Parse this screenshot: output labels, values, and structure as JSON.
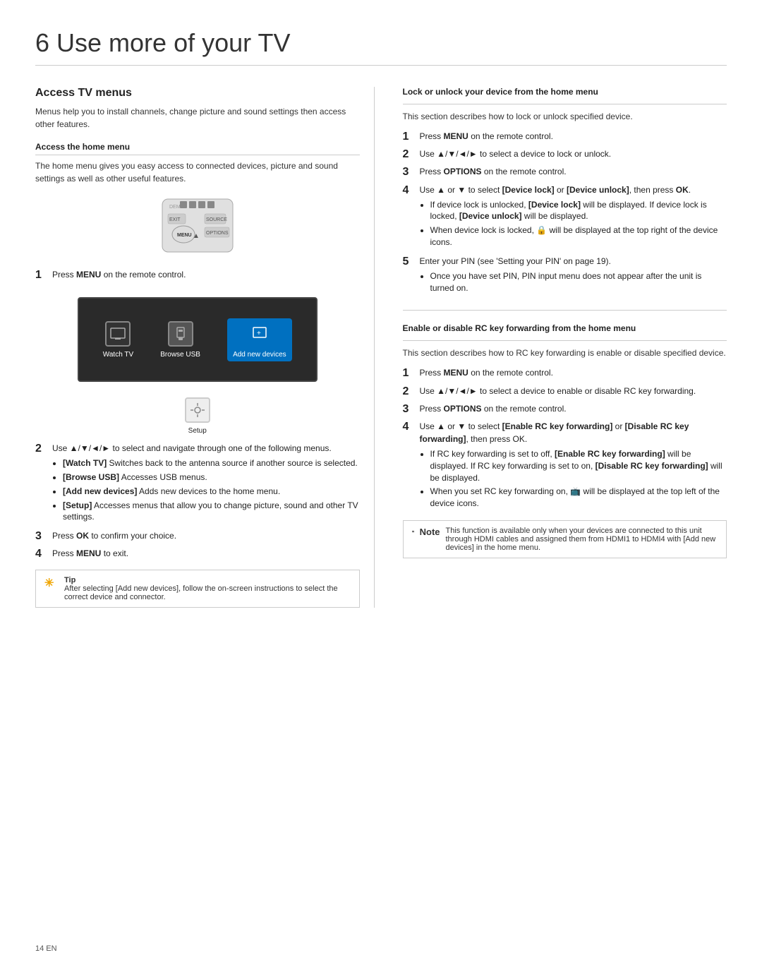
{
  "page": {
    "title": "6   Use more of your TV",
    "page_number": "14   EN"
  },
  "left": {
    "section_title": "Access TV menus",
    "intro_text": "Menus help you to install channels, change picture and sound settings then access other features.",
    "home_menu_subtitle": "Access the home menu",
    "home_menu_text": "The home menu gives you easy access to connected devices, picture and sound settings as well as other useful features.",
    "menu_items": [
      {
        "label": "Watch TV",
        "type": "tv"
      },
      {
        "label": "Browse USB",
        "type": "usb"
      },
      {
        "label": "Add new devices",
        "type": "add"
      },
      {
        "label": "Setup",
        "type": "setup"
      }
    ],
    "steps": [
      {
        "num": "1",
        "text": "Press MENU on the remote control.",
        "bold_word": "MENU"
      },
      {
        "num": "2",
        "text": "Use ▲/▼/◄/► to select and navigate through one of the following menus.",
        "bullets": [
          "[Watch TV] Switches back to the antenna source if another source is selected.",
          "[Browse USB] Accesses USB menus.",
          "[Add new devices] Adds new devices to the home menu.",
          "[Setup] Accesses menus that allow you to change picture, sound and other TV settings."
        ]
      },
      {
        "num": "3",
        "text": "Press OK to confirm your choice.",
        "bold_word": "OK"
      },
      {
        "num": "4",
        "text": "Press MENU to exit.",
        "bold_word": "MENU"
      }
    ],
    "tip_label": "Tip",
    "tip_text": "After selecting [Add new devices], follow the on-screen instructions to select the correct device and connector."
  },
  "right": {
    "lock_section": {
      "title": "Lock or unlock your device from the home menu",
      "intro": "This section describes how to lock or unlock specified device.",
      "steps": [
        {
          "num": "1",
          "text": "Press MENU on the remote control.",
          "bold": "MENU"
        },
        {
          "num": "2",
          "text": "Use ▲/▼/◄/► to select a device to lock or unlock."
        },
        {
          "num": "3",
          "text": "Press OPTIONS on the remote control.",
          "bold": "OPTIONS"
        },
        {
          "num": "4",
          "text": "Use ▲ or ▼ to select [Device lock] or [Device unlock], then press OK.",
          "bullets": [
            "If device lock is unlocked, [Device lock] will be displayed. If device lock is locked, [Device unlock] will be displayed.",
            "When device lock is locked, 🔒 will be displayed at the top right of the device icons."
          ]
        },
        {
          "num": "5",
          "text": "Enter your PIN (see 'Setting your PIN' on page 19).",
          "bullets": [
            "Once you have set PIN, PIN input menu does not appear after the unit is turned on."
          ]
        }
      ]
    },
    "rc_section": {
      "title": "Enable or disable RC key forwarding from the home menu",
      "intro": "This section describes how to RC key forwarding is enable or disable specified device.",
      "steps": [
        {
          "num": "1",
          "text": "Press MENU on the remote control.",
          "bold": "MENU"
        },
        {
          "num": "2",
          "text": "Use ▲/▼/◄/► to select a device to enable or disable RC key forwarding."
        },
        {
          "num": "3",
          "text": "Press OPTIONS on the remote control.",
          "bold": "OPTIONS"
        },
        {
          "num": "4",
          "text": "Use ▲ or ▼ to select [Enable RC key forwarding] or [Disable RC key forwarding], then press OK.",
          "bullets": [
            "If RC key forwarding is set to off, [Enable RC key forwarding] will be displayed. If RC key forwarding is set to on, [Disable RC key forwarding] will be displayed.",
            "When you set RC key forwarding on, 📺 will be displayed at the top left of the device icons."
          ]
        }
      ],
      "note_label": "Note",
      "note_text": "This function is available only when your devices are connected to this unit through HDMI cables and assigned them from HDMI1 to HDMI4 with [Add new devices] in the home menu."
    }
  }
}
